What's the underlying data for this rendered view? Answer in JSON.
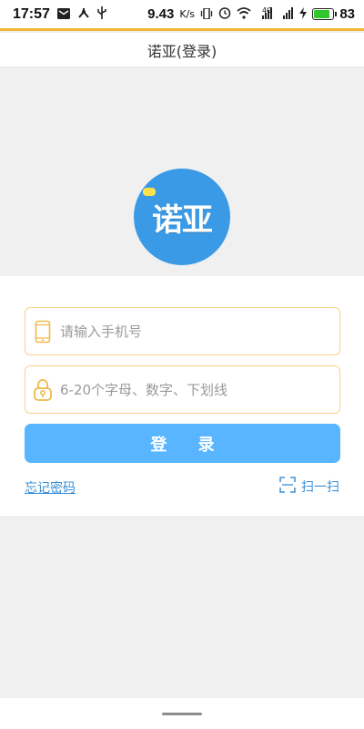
{
  "status_bar": {
    "time": "17:57",
    "net_speed": "9.43",
    "speed_unit": "K/s",
    "signal_1": "4G",
    "signal_2": "4G",
    "battery": "83"
  },
  "header": {
    "title": "诺亚(登录)"
  },
  "logo": {
    "text": "诺亚",
    "brand_color": "#3a9ae6"
  },
  "form": {
    "phone": {
      "value": "",
      "placeholder": "请输入手机号"
    },
    "password": {
      "value": "",
      "placeholder": "6-20个字母、数字、下划线"
    },
    "login_label": "登 录",
    "forgot_label": "忘记密码",
    "scan_label": "扫一扫"
  },
  "colors": {
    "accent": "#59b5ff",
    "input_border": "#f5d48a",
    "link": "#3a8fd6",
    "status_line": "#f3b732"
  }
}
